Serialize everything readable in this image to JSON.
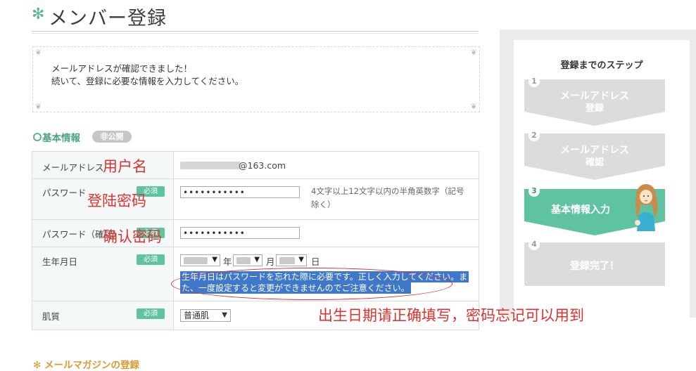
{
  "header": {
    "icon": "asterisk-icon",
    "title": "メンバー登録"
  },
  "notice": {
    "line1": "メールアドレスが確認できました！",
    "line2": "続いて、登録に必要な情報を入力してください。"
  },
  "section": {
    "title": "基本情報",
    "badge": "非公開"
  },
  "required_label": "必須",
  "form": {
    "email": {
      "label": "メールアドレス",
      "value_suffix": "@163.com"
    },
    "password": {
      "label": "パスワード",
      "value": "•••••••••••",
      "hint": "4文字以上12文字以内の半角英数字（記号除く）"
    },
    "password_confirm": {
      "label": "パスワード（確認）",
      "value": "•••••••••••"
    },
    "birthday": {
      "label": "生年月日",
      "year_unit": "年",
      "month_unit": "月",
      "day_unit": "日",
      "note_line1": "生年月日はパスワードを忘れた際に必要です。正しく入力してください。ま",
      "note_line2": "た、一度設定すると変更ができませんのでご注意ください。"
    },
    "skin": {
      "label": "肌質",
      "selected": "普通肌"
    }
  },
  "sidebar": {
    "title": "登録までのステップ",
    "steps": [
      {
        "num": "1",
        "line1": "メールアドレス",
        "line2": "登録",
        "active": false
      },
      {
        "num": "2",
        "line1": "メールアドレス",
        "line2": "確認",
        "active": false
      },
      {
        "num": "3",
        "line1": "基本情報入力",
        "line2": "",
        "active": true
      },
      {
        "num": "4",
        "line1": "登録完了！",
        "line2": "",
        "active": false
      }
    ],
    "colors": {
      "active": "#5fc3a2",
      "inactive": "#dcdcdc"
    }
  },
  "annotations": {
    "username": "用户名",
    "login_password": "登陆密码",
    "confirm_password": "确认密码",
    "birthday_note": "出生日期请正确填写，密码忘记可以用到"
  },
  "next_section": {
    "title": "メールマガジンの登録"
  }
}
